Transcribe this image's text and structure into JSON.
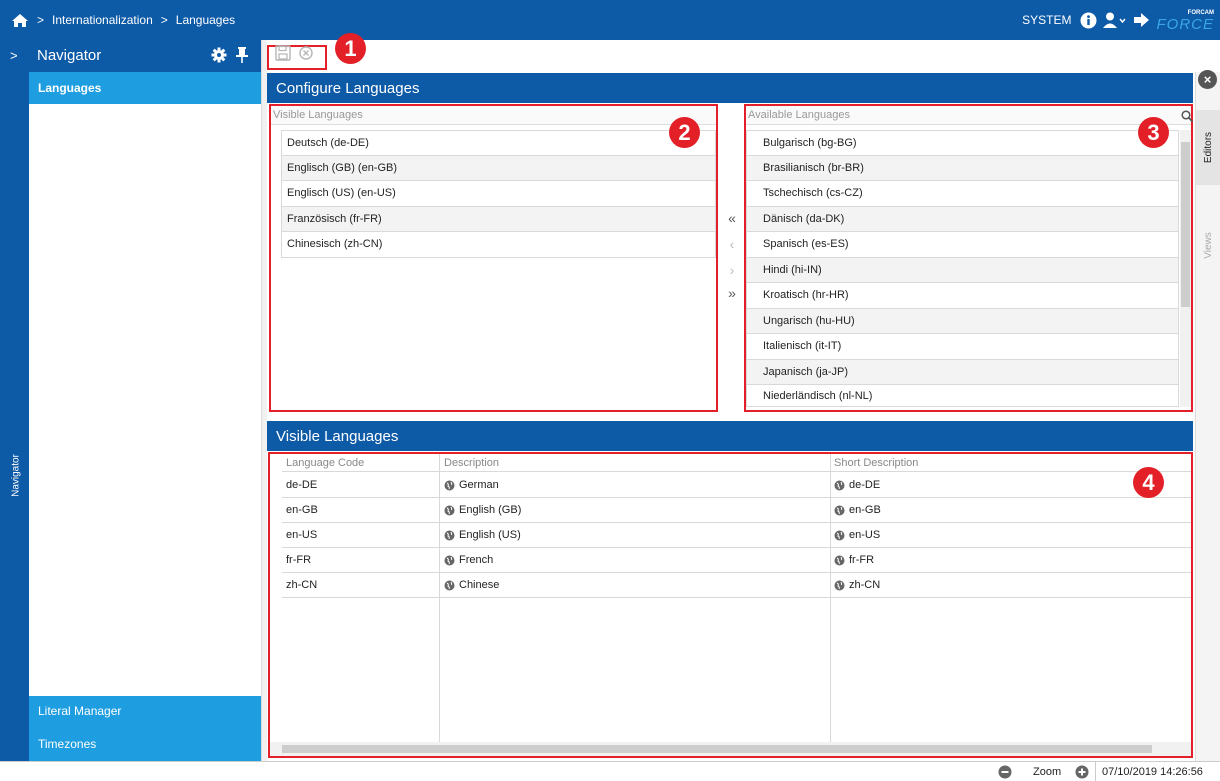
{
  "topbar": {
    "breadcrumb": [
      "Internationalization",
      "Languages"
    ],
    "user": "SYSTEM",
    "brand_top": "FORCAM",
    "brand_main": "FORCE"
  },
  "navigator": {
    "title": "Navigator",
    "rail_label": "Navigator",
    "items": [
      {
        "label": "Languages",
        "active": true
      },
      {
        "label": "Literal Manager",
        "active": false
      },
      {
        "label": "Timezones",
        "active": false
      }
    ]
  },
  "callouts": [
    "1",
    "2",
    "3",
    "4"
  ],
  "configure": {
    "title": "Configure Languages",
    "visible_header": "Visible Languages",
    "visible": [
      "Deutsch (de-DE)",
      "Englisch (GB) (en-GB)",
      "Englisch (US) (en-US)",
      "Französisch (fr-FR)",
      "Chinesisch (zh-CN)"
    ],
    "available_header": "Available Languages",
    "available": [
      "Bulgarisch (bg-BG)",
      "Brasilianisch (br-BR)",
      "Tschechisch (cs-CZ)",
      "Dänisch (da-DK)",
      "Spanisch (es-ES)",
      "Hindi (hi-IN)",
      "Kroatisch (hr-HR)",
      "Ungarisch (hu-HU)",
      "Italienisch (it-IT)",
      "Japanisch (ja-JP)",
      "Niederländisch (nl-NL)"
    ],
    "transfer": {
      "all_left": "«",
      "left": "‹",
      "right": "›",
      "all_right": "»"
    }
  },
  "visible_table": {
    "title": "Visible Languages",
    "columns": [
      "Language Code",
      "Description",
      "Short Description"
    ],
    "rows": [
      [
        "de-DE",
        "German",
        "de-DE"
      ],
      [
        "en-GB",
        "English (GB)",
        "en-GB"
      ],
      [
        "en-US",
        "English (US)",
        "en-US"
      ],
      [
        "fr-FR",
        "French",
        "fr-FR"
      ],
      [
        "zh-CN",
        "Chinese",
        "zh-CN"
      ]
    ]
  },
  "side_tabs": [
    "Editors",
    "Views"
  ],
  "status": {
    "zoom_label": "Zoom",
    "datetime": "07/10/2019 14:26:56"
  },
  "colors": {
    "primary": "#0d5aa7",
    "nav_item": "#1e9de0",
    "callout": "#e32027",
    "brand_accent": "#3aa7e3"
  }
}
